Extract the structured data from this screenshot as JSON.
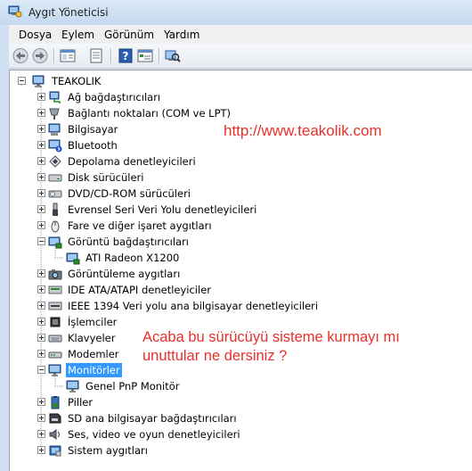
{
  "window": {
    "title": "Aygıt Yöneticisi"
  },
  "menu": [
    "Dosya",
    "Eylem",
    "Görünüm",
    "Yardım"
  ],
  "toolbar": [
    "back-icon",
    "forward-icon",
    "properties-pane-icon",
    "show-hidden-icon",
    "help-icon",
    "console-tree-icon",
    "scan-hardware-icon"
  ],
  "tree": {
    "root": "TEAKOLIK",
    "items": [
      {
        "label": "Ağ bağdaştırıcıları",
        "icon": "network-adapter-icon",
        "expanded": false
      },
      {
        "label": "Bağlantı noktaları (COM ve LPT)",
        "icon": "port-icon",
        "expanded": false
      },
      {
        "label": "Bilgisayar",
        "icon": "computer-icon",
        "expanded": false
      },
      {
        "label": "Bluetooth",
        "icon": "bluetooth-icon",
        "expanded": false
      },
      {
        "label": "Depolama denetleyicileri",
        "icon": "storage-controller-icon",
        "expanded": false
      },
      {
        "label": "Disk sürücüleri",
        "icon": "disk-drive-icon",
        "expanded": false
      },
      {
        "label": "DVD/CD-ROM sürücüleri",
        "icon": "dvd-drive-icon",
        "expanded": false
      },
      {
        "label": "Evrensel Seri Veri Yolu denetleyicileri",
        "icon": "usb-icon",
        "expanded": false
      },
      {
        "label": "Fare ve diğer işaret aygıtları",
        "icon": "mouse-icon",
        "expanded": false
      },
      {
        "label": "Görüntü bağdaştırıcıları",
        "icon": "display-adapter-icon",
        "expanded": true,
        "children": [
          {
            "label": "ATI Radeon X1200",
            "icon": "display-adapter-icon"
          }
        ]
      },
      {
        "label": "Görüntüleme aygıtları",
        "icon": "camera-icon",
        "expanded": false
      },
      {
        "label": "IDE ATA/ATAPI denetleyiciler",
        "icon": "ide-controller-icon",
        "expanded": false
      },
      {
        "label": "IEEE 1394 Veri yolu ana bilgisayar denetleyicileri",
        "icon": "ieee1394-icon",
        "expanded": false
      },
      {
        "label": "İşlemciler",
        "icon": "processor-icon",
        "expanded": false
      },
      {
        "label": "Klavyeler",
        "icon": "keyboard-icon",
        "expanded": false
      },
      {
        "label": "Modemler",
        "icon": "modem-icon",
        "expanded": false
      },
      {
        "label": "Monitörler",
        "icon": "monitor-icon",
        "expanded": true,
        "selected": true,
        "children": [
          {
            "label": "Genel PnP Monitör",
            "icon": "monitor-icon"
          }
        ]
      },
      {
        "label": "Piller",
        "icon": "battery-icon",
        "expanded": false
      },
      {
        "label": "SD ana bilgisayar bağdaştırıcıları",
        "icon": "sd-adapter-icon",
        "expanded": false
      },
      {
        "label": "Ses, video ve oyun denetleyicileri",
        "icon": "sound-icon",
        "expanded": false
      },
      {
        "label": "Sistem aygıtları",
        "icon": "system-device-icon",
        "expanded": false
      }
    ]
  },
  "annotations": {
    "url": "http://www.teakolik.com",
    "question_line1": "Acaba bu sürücüyü sisteme kurmayı mı",
    "question_line2": "unuttular ne dersiniz ?"
  },
  "colors": {
    "selection": "#3399ff",
    "annotation": "#e8302c",
    "titlebar": "#c4d8ef"
  }
}
